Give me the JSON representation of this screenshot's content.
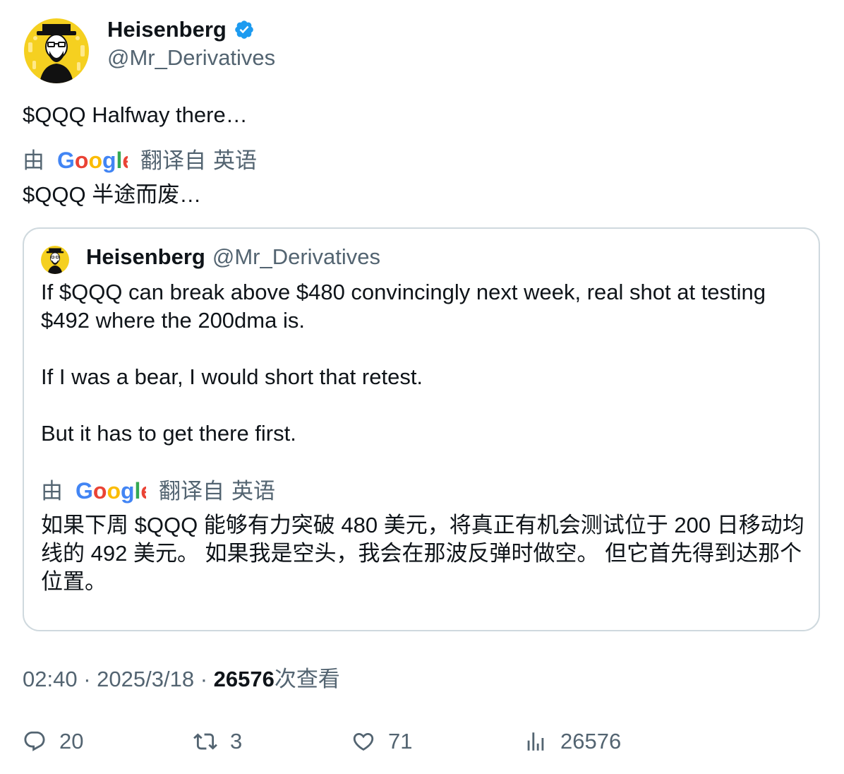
{
  "author": {
    "name": "Heisenberg",
    "handle": "@Mr_Derivatives",
    "verified_icon": "verified-badge-icon",
    "avatar_icon": "heisenberg-avatar"
  },
  "tweet": {
    "text": "$QQQ Halfway there…",
    "translation": {
      "prefix": "由",
      "logo_text": "Google",
      "suffix": "翻译自",
      "language": "英语",
      "text": "$QQQ 半途而废…"
    }
  },
  "quote": {
    "name": "Heisenberg",
    "handle": "@Mr_Derivatives",
    "paragraphs": [
      "If $QQQ can break above $480 convincingly next week, real shot at testing $492 where the 200dma is.",
      "If I was a bear, I would short that retest.",
      "But it has to get there first."
    ],
    "translation": {
      "prefix": "由",
      "logo_text": "Google",
      "suffix": "翻译自",
      "language": "英语",
      "text": "如果下周 $QQQ 能够有力突破 480 美元，将真正有机会测试位于 200 日移动均线的 492 美元。 如果我是空头，我会在那波反弹时做空。 但它首先得到达那个位置。"
    }
  },
  "meta": {
    "time": "02:40",
    "sep1": "·",
    "date": "2025/3/18",
    "sep2": "·",
    "views": "26576",
    "views_suffix": "次查看"
  },
  "actions": {
    "replies": "20",
    "retweets": "3",
    "likes": "71",
    "views": "26576"
  },
  "colors": {
    "text": "#0f1419",
    "secondary": "#536471",
    "border": "#cfd9de",
    "verified": "#1d9bf0",
    "avatar_bg": "#f5d020"
  }
}
